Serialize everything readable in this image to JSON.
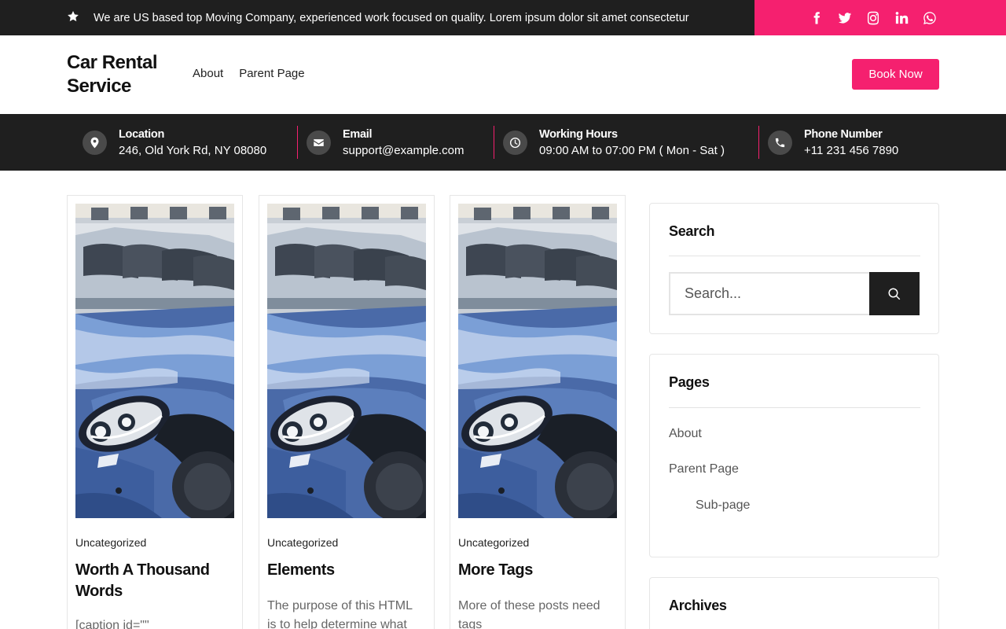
{
  "topbar": {
    "notice": "We are US based top Moving Company, experienced work focused on quality. Lorem ipsum dolor sit amet consectetur",
    "notice_icon": "star-icon",
    "social_icons": [
      "facebook-icon",
      "twitter-icon",
      "instagram-icon",
      "linkedin-icon",
      "whatsapp-icon"
    ],
    "accent_color": "#f5206f"
  },
  "header": {
    "site_title": "Car Rental Service",
    "nav": [
      "About",
      "Parent Page"
    ],
    "cta": "Book Now"
  },
  "info": {
    "location": {
      "label": "Location",
      "value": "246, Old York Rd, NY 08080"
    },
    "email": {
      "label": "Email",
      "value": "support@example.com"
    },
    "hours": {
      "label": "Working Hours",
      "value": "09:00 AM to 07:00 PM ( Mon - Sat )"
    },
    "phone": {
      "label": "Phone Number",
      "value": "+11 231 456 7890"
    }
  },
  "posts": [
    {
      "category": "Uncategorized",
      "title": "Worth A Thousand Words",
      "excerpt": "[caption id=\"\""
    },
    {
      "category": "Uncategorized",
      "title": "Elements",
      "excerpt": "The purpose of this HTML is to help determine what"
    },
    {
      "category": "Uncategorized",
      "title": "More Tags",
      "excerpt": "More of these posts need tags"
    }
  ],
  "sidebar": {
    "search": {
      "title": "Search",
      "placeholder": "Search..."
    },
    "pages": {
      "title": "Pages",
      "items": [
        "About",
        "Parent Page",
        "Sub-page"
      ]
    },
    "archives": {
      "title": "Archives"
    }
  }
}
